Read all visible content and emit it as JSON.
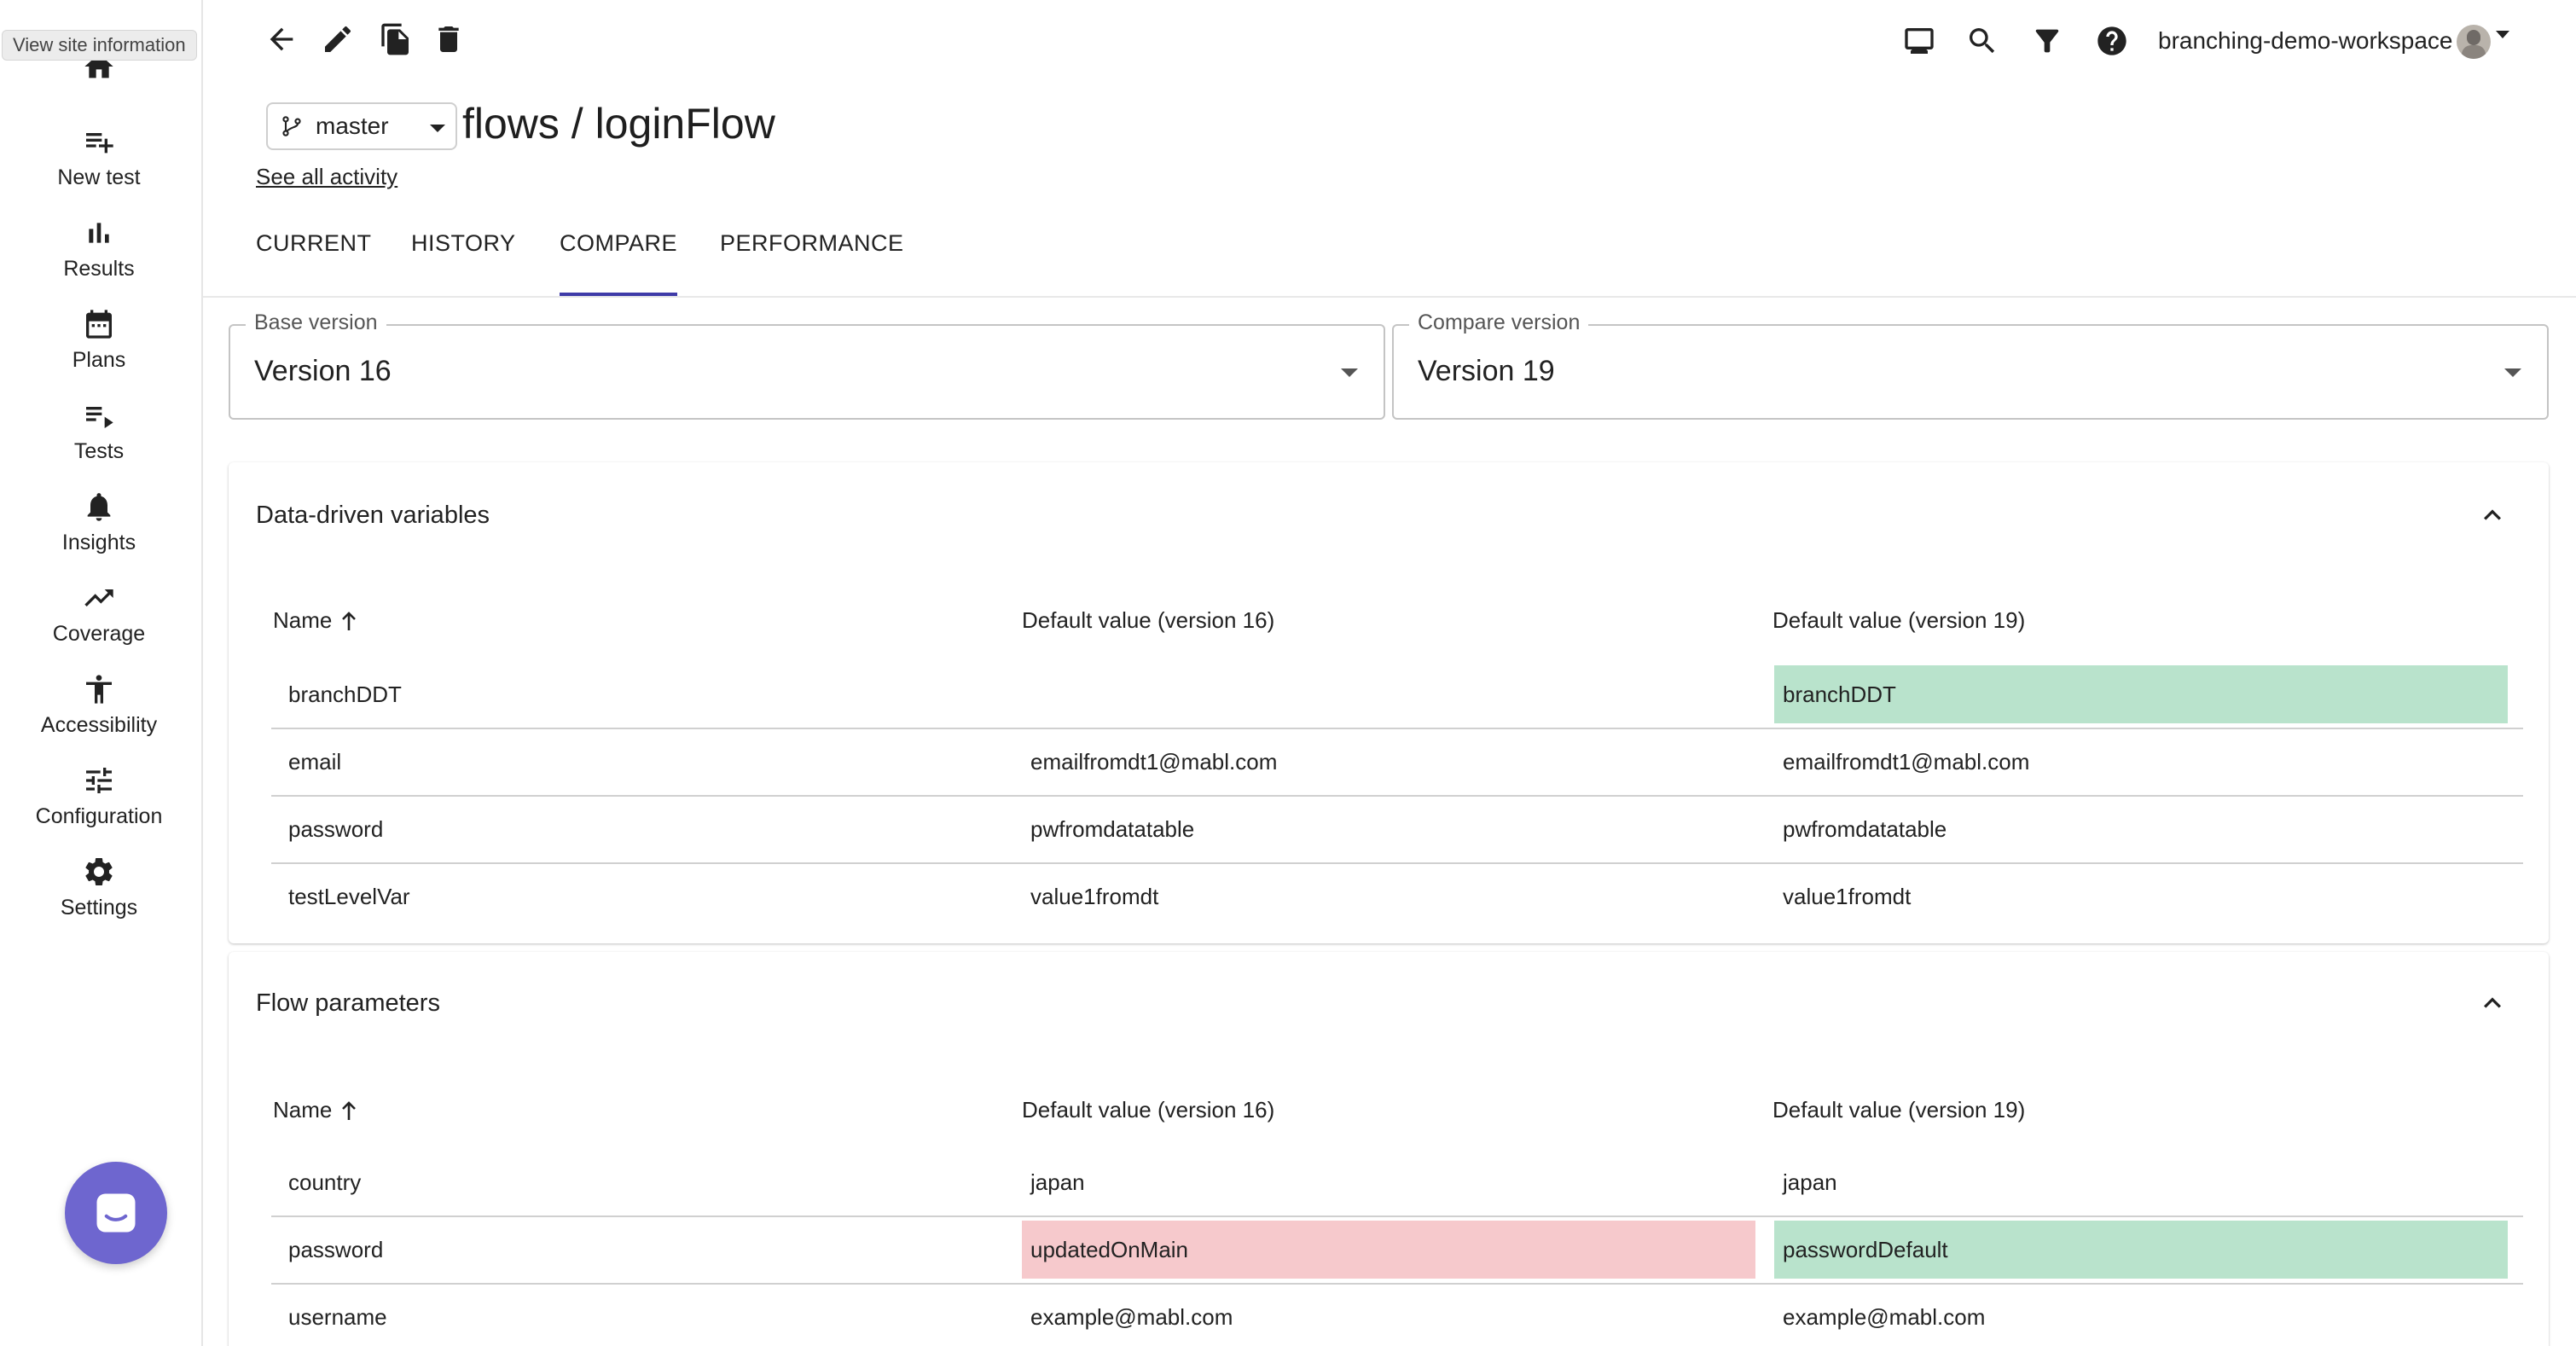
{
  "browser": {
    "tooltip": "View site information"
  },
  "sidebar": {
    "items": [
      {
        "label": "New test",
        "icon": "playlist-add-icon"
      },
      {
        "label": "Results",
        "icon": "bar-chart-icon"
      },
      {
        "label": "Plans",
        "icon": "calendar-icon"
      },
      {
        "label": "Tests",
        "icon": "playlist-play-icon"
      },
      {
        "label": "Insights",
        "icon": "bell-icon"
      },
      {
        "label": "Coverage",
        "icon": "trending-up-icon"
      },
      {
        "label": "Accessibility",
        "icon": "accessibility-icon"
      },
      {
        "label": "Configuration",
        "icon": "tune-icon"
      },
      {
        "label": "Settings",
        "icon": "gear-icon"
      }
    ]
  },
  "header": {
    "workspace": "branching-demo-workspace",
    "branch": "master",
    "title": "flows / loginFlow",
    "activity_link": "See all activity"
  },
  "tabs": [
    "CURRENT",
    "HISTORY",
    "COMPARE",
    "PERFORMANCE"
  ],
  "active_tab": "COMPARE",
  "compare": {
    "base": {
      "label": "Base version",
      "value": "Version 16"
    },
    "target": {
      "label": "Compare version",
      "value": "Version 19"
    }
  },
  "sections": [
    {
      "title": "Data-driven variables",
      "headers": [
        "Name",
        "Default value (version 16)",
        "Default value (version 19)"
      ],
      "rows": [
        {
          "name": "branchDDT",
          "v1": "",
          "v2": "branchDDT",
          "status": "added"
        },
        {
          "name": "email",
          "v1": "emailfromdt1@mabl.com",
          "v2": "emailfromdt1@mabl.com",
          "status": "same"
        },
        {
          "name": "password",
          "v1": "pwfromdatatable",
          "v2": "pwfromdatatable",
          "status": "same"
        },
        {
          "name": "testLevelVar",
          "v1": "value1fromdt",
          "v2": "value1fromdt",
          "status": "same"
        }
      ]
    },
    {
      "title": "Flow parameters",
      "headers": [
        "Name",
        "Default value (version 16)",
        "Default value (version 19)"
      ],
      "rows": [
        {
          "name": "country",
          "v1": "japan",
          "v2": "japan",
          "status": "same"
        },
        {
          "name": "password",
          "v1": "updatedOnMain",
          "v2": "passwordDefault",
          "status": "changed"
        },
        {
          "name": "username",
          "v1": "example@mabl.com",
          "v2": "example@mabl.com",
          "status": "same"
        }
      ]
    }
  ],
  "colors": {
    "accent": "#3f3ba8",
    "added": "#b9e3cc",
    "removed": "#f6c9cc",
    "fab": "#6e66cf"
  }
}
